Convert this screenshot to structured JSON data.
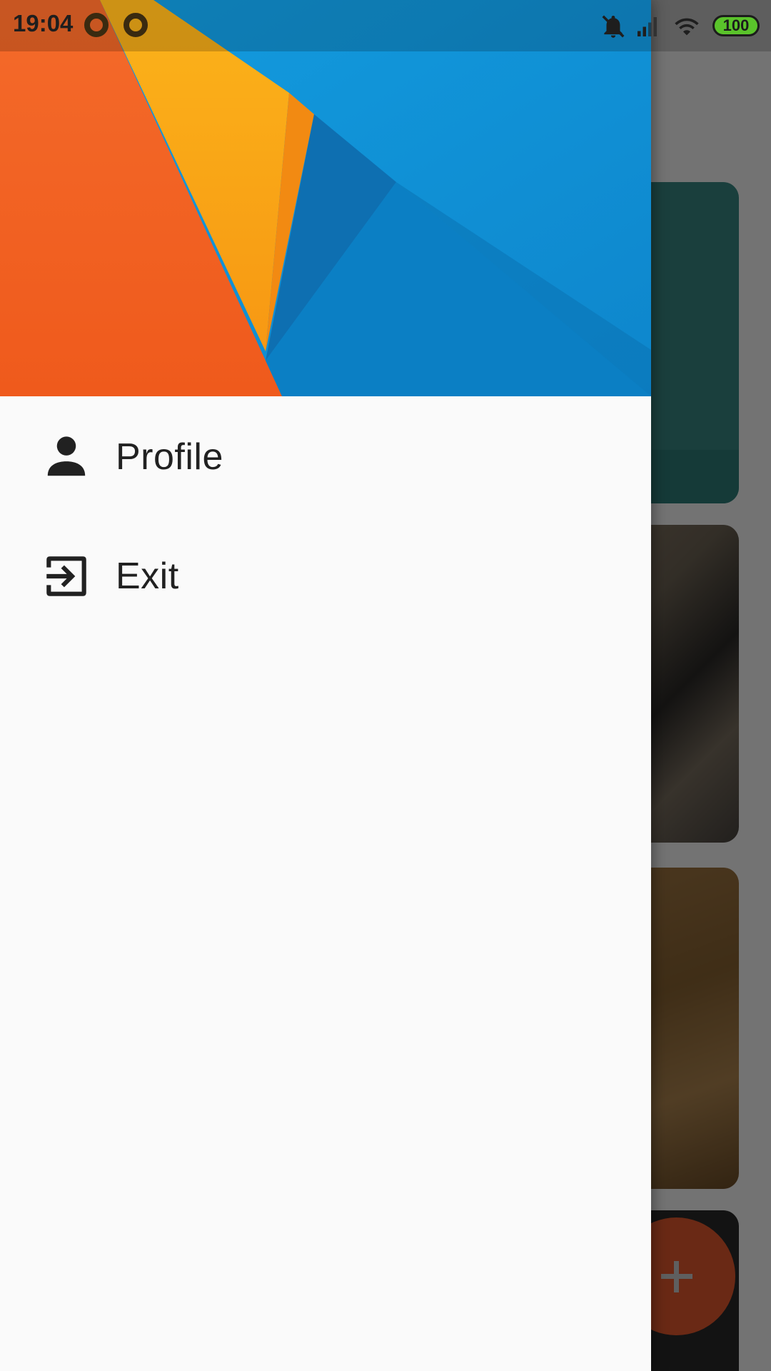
{
  "status_bar": {
    "time": "19:04",
    "battery": "100",
    "battery_color": "#5ac32b",
    "icons": [
      "notification-dot-icon",
      "notification-dot-icon",
      "bell-off-icon",
      "signal-icon",
      "wifi-icon",
      "battery-icon"
    ]
  },
  "drawer": {
    "header_image": "material-abstract-wallpaper",
    "items": [
      {
        "label": "Profile",
        "icon": "person-icon"
      },
      {
        "label": "Exit",
        "icon": "exit-icon"
      }
    ]
  },
  "background": {
    "fab_icon": "plus-icon",
    "fab_color": "#e85a2e"
  }
}
